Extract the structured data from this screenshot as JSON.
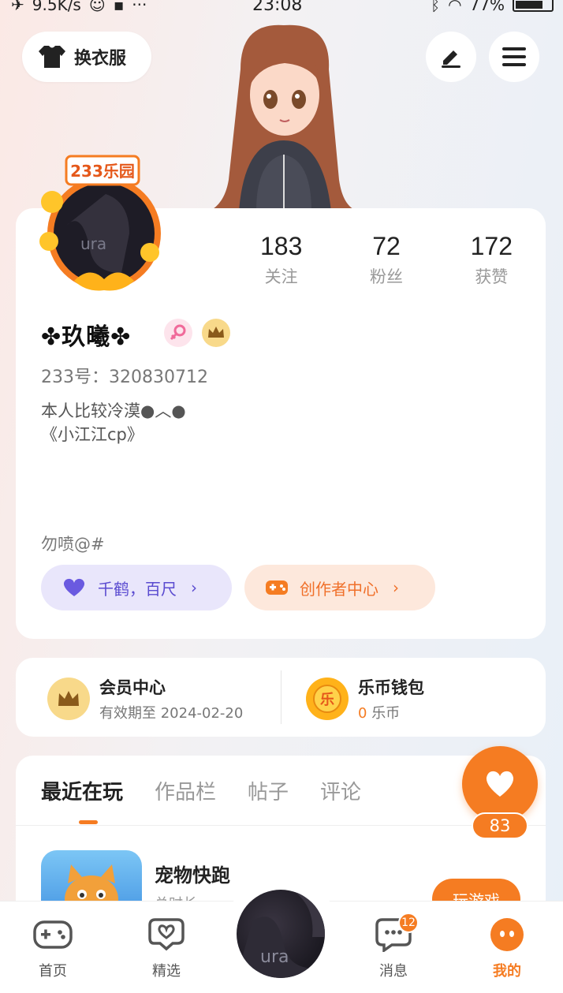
{
  "status_bar": {
    "net_speed": "9.5K/s",
    "time": "23:08",
    "battery": "77%"
  },
  "header": {
    "outfit_label": "换衣服",
    "edit_icon": "pencil-icon",
    "menu_icon": "menu-icon"
  },
  "avatar": {
    "frame_label": "233乐园"
  },
  "profile": {
    "stats": [
      {
        "value": "183",
        "label": "关注"
      },
      {
        "value": "72",
        "label": "粉丝"
      },
      {
        "value": "172",
        "label": "获赞"
      }
    ],
    "nickname": "✤玖曦✤",
    "uid": "233号：320830712",
    "bio": "本人比较冷漠●︿●\n《小江江cp》",
    "tagline": "勿喷@#",
    "crane_pill": "千鹤，百尺",
    "creator_pill": "创作者中心"
  },
  "member": {
    "vip_title": "会员中心",
    "vip_sub": "有效期至 2024-02-20",
    "wallet_title": "乐币钱包",
    "wallet_amount": "0",
    "wallet_unit": "乐币"
  },
  "tabs": {
    "items": [
      "最近在玩",
      "作品栏",
      "帖子",
      "评论"
    ],
    "active_index": 0
  },
  "recent_game": {
    "name": "宠物快跑",
    "sub": "总时长",
    "play_label": "玩游戏"
  },
  "like": {
    "count": "83"
  },
  "bottom_nav": {
    "items": [
      {
        "label": "首页",
        "icon": "gamepad-icon"
      },
      {
        "label": "精选",
        "icon": "heart-chat-icon"
      },
      {
        "label": "消息",
        "icon": "message-icon",
        "badge": "12"
      },
      {
        "label": "我的",
        "icon": "profile-face-icon"
      }
    ]
  },
  "colors": {
    "accent": "#f57c22",
    "purple": "#5a4bd0"
  }
}
